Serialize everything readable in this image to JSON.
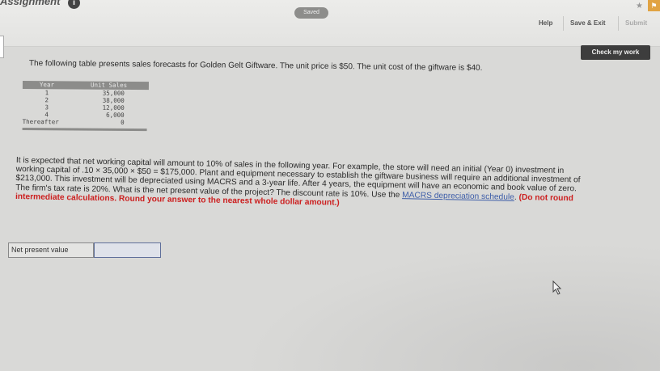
{
  "topbar": {
    "assignment_label": "Assignment",
    "info_badge": "i",
    "saved_label": "Saved",
    "help_label": "Help",
    "save_exit_label": "Save & Exit",
    "submit_label": "Submit",
    "star_glyph": "★",
    "flag_glyph": "⚑"
  },
  "check_work_label": "Check my work",
  "intro_text": "The following table presents sales forecasts for Golden Gelt Giftware. The unit price is $50. The unit cost of the giftware is $40.",
  "table": {
    "headers": [
      "Year",
      "Unit Sales"
    ],
    "rows": [
      {
        "year": "1",
        "sales": "35,000"
      },
      {
        "year": "2",
        "sales": "38,000"
      },
      {
        "year": "3",
        "sales": "12,000"
      },
      {
        "year": "4",
        "sales": "6,000"
      },
      {
        "year": "Thereafter",
        "sales": "0"
      }
    ]
  },
  "problem": {
    "text_main": "It is expected that net working capital will amount to 10% of sales in the following year. For example, the store will need an initial (Year 0) investment in working capital of .10 × 35,000 × $50 = $175,000. Plant and equipment necessary to establish the giftware business will require an additional investment of $213,000. This investment will be depreciated using MACRS and a 3-year life. After 4 years, the equipment will have an economic and book value of zero. The firm's tax rate is 20%. What is the net present value of the project? The discount rate is 10%. Use the ",
    "link_text": "MACRS depreciation schedule",
    "text_after_link": ". ",
    "warning": "(Do not round intermediate calculations. Round your answer to the nearest whole dollar amount.)"
  },
  "answer": {
    "label": "Net present value",
    "value": ""
  }
}
